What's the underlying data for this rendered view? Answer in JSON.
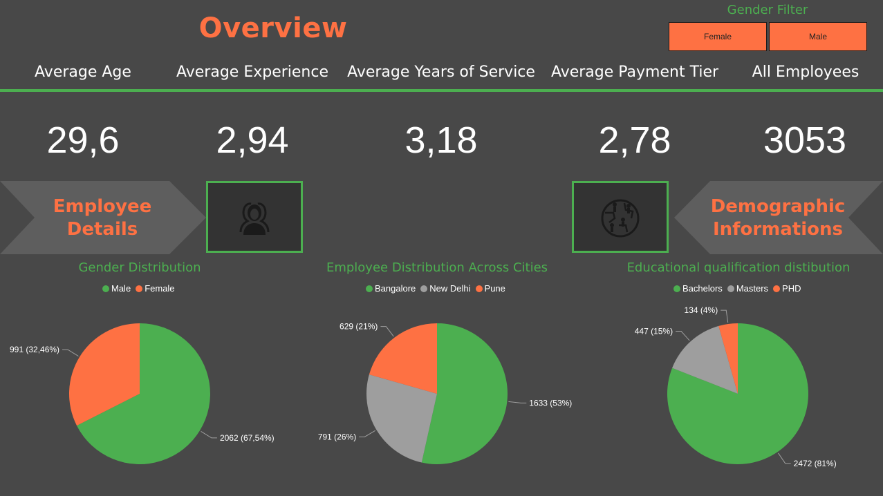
{
  "header": {
    "title": "Overview"
  },
  "filter": {
    "label": "Gender Filter",
    "buttons": [
      "Female",
      "Male"
    ]
  },
  "kpis": {
    "labels": [
      "Average Age",
      "Average Experience",
      "Average Years of Service",
      "Average Payment Tier",
      "All Employees"
    ],
    "values": [
      "29,6",
      "2,94",
      "3,18",
      "2,78",
      "3053"
    ]
  },
  "banners": {
    "left": {
      "line1": "Employee",
      "line2": "Details"
    },
    "right": {
      "line1": "Demographic",
      "line2": "Informations"
    }
  },
  "icons": {
    "left": "employees-icon",
    "right": "globe-people-icon"
  },
  "colors": {
    "background": "#484848",
    "accent": "#fe7143",
    "green": "#4caf50",
    "gray": "#9e9e9e",
    "banner": "#5e5e5e"
  },
  "chart_data": [
    {
      "type": "pie",
      "title": "Gender Distribution",
      "categories": [
        "Male",
        "Female"
      ],
      "values": [
        2062,
        991
      ],
      "labels": [
        "2062 (67,54%)",
        "991 (32,46%)"
      ],
      "colors": [
        "#4caf50",
        "#fe7143"
      ],
      "legend_position": "top"
    },
    {
      "type": "pie",
      "title": "Employee Distribution Across Cities",
      "categories": [
        "Bangalore",
        "New Delhi",
        "Pune"
      ],
      "values": [
        1633,
        791,
        629
      ],
      "labels": [
        "1633 (53%)",
        "791 (26%)",
        "629 (21%)"
      ],
      "colors": [
        "#4caf50",
        "#9e9e9e",
        "#fe7143"
      ],
      "legend_position": "top"
    },
    {
      "type": "pie",
      "title": "Educational qualification distibution",
      "categories": [
        "Bachelors",
        "Masters",
        "PHD"
      ],
      "values": [
        2472,
        447,
        134
      ],
      "labels": [
        "2472 (81%)",
        "447 (15%)",
        "134 (4%)"
      ],
      "colors": [
        "#4caf50",
        "#9e9e9e",
        "#fe7143"
      ],
      "legend_position": "top"
    }
  ]
}
